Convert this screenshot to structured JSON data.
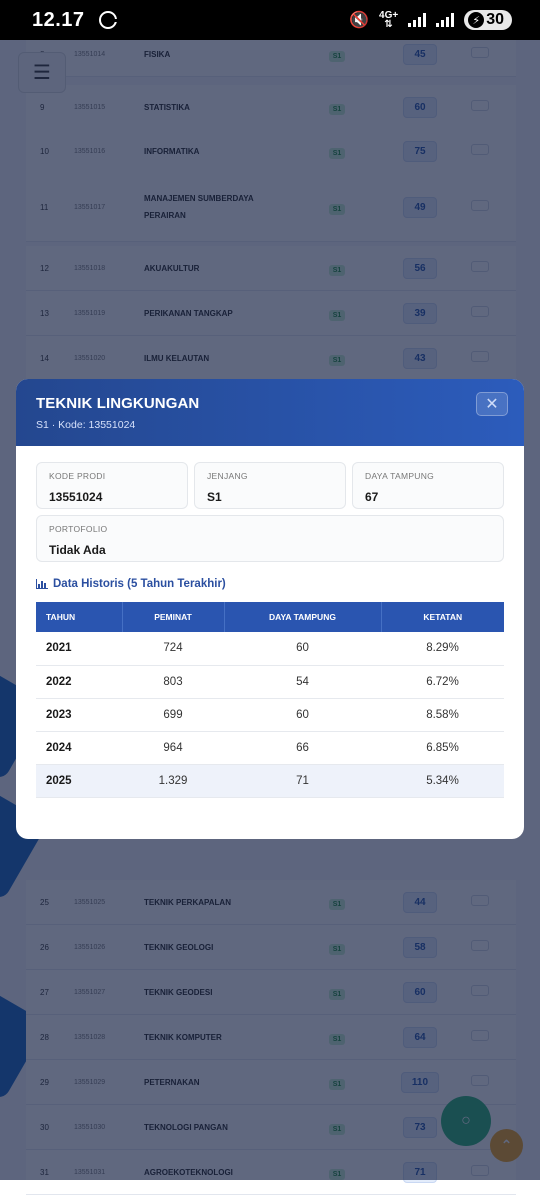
{
  "status_bar": {
    "time": "12.17",
    "network": "4G+",
    "battery": "30"
  },
  "background": {
    "menu_icon": "hamburger-icon",
    "rows": [
      {
        "no": "8",
        "code": "13551014",
        "name": "FISIKA",
        "jenjang": "S1",
        "daya": "45"
      },
      {
        "no": "9",
        "code": "13551015",
        "name": "STATISTIKA",
        "jenjang": "S1",
        "daya": "60"
      },
      {
        "no": "10",
        "code": "13551016",
        "name": "INFORMATIKA",
        "jenjang": "S1",
        "daya": "75"
      },
      {
        "no": "11",
        "code": "13551017",
        "name": "MANAJEMEN SUMBERDAYA PERAIRAN",
        "jenjang": "S1",
        "daya": "49"
      },
      {
        "no": "12",
        "code": "13551018",
        "name": "AKUAKULTUR",
        "jenjang": "S1",
        "daya": "56"
      },
      {
        "no": "13",
        "code": "13551019",
        "name": "PERIKANAN TANGKAP",
        "jenjang": "S1",
        "daya": "39"
      },
      {
        "no": "14",
        "code": "13551020",
        "name": "ILMU KELAUTAN",
        "jenjang": "S1",
        "daya": "43"
      },
      {
        "no": "25",
        "code": "13551025",
        "name": "TEKNIK PERKAPALAN",
        "jenjang": "S1",
        "daya": "44"
      },
      {
        "no": "26",
        "code": "13551026",
        "name": "TEKNIK GEOLOGI",
        "jenjang": "S1",
        "daya": "58"
      },
      {
        "no": "27",
        "code": "13551027",
        "name": "TEKNIK GEODESI",
        "jenjang": "S1",
        "daya": "60"
      },
      {
        "no": "28",
        "code": "13551028",
        "name": "TEKNIK KOMPUTER",
        "jenjang": "S1",
        "daya": "64"
      },
      {
        "no": "29",
        "code": "13551029",
        "name": "PETERNAKAN",
        "jenjang": "S1",
        "daya": "110"
      },
      {
        "no": "30",
        "code": "13551030",
        "name": "TEKNOLOGI PANGAN",
        "jenjang": "S1",
        "daya": "73"
      },
      {
        "no": "31",
        "code": "13551031",
        "name": "AGROEKOTEKNOLOGI",
        "jenjang": "S1",
        "daya": "71"
      }
    ]
  },
  "modal": {
    "title": "TEKNIK LINGKUNGAN",
    "subtitle": "S1 · Kode: 13551024",
    "close_icon": "close-icon",
    "info": {
      "kode_label": "KODE PRODI",
      "kode_value": "13551024",
      "jenjang_label": "JENJANG",
      "jenjang_value": "S1",
      "daya_label": "DAYA TAMPUNG",
      "daya_value": "67",
      "porto_label": "PORTOFOLIO",
      "porto_value": "Tidak Ada"
    },
    "history_title": "Data Historis (5 Tahun Terakhir)",
    "history_icon": "bar-chart-icon",
    "table": {
      "headers": [
        "TAHUN",
        "PEMINAT",
        "DAYA TAMPUNG",
        "KETATAN"
      ],
      "rows": [
        [
          "2021",
          "724",
          "60",
          "8.29%"
        ],
        [
          "2022",
          "803",
          "54",
          "6.72%"
        ],
        [
          "2023",
          "699",
          "60",
          "8.58%"
        ],
        [
          "2024",
          "964",
          "66",
          "6.85%"
        ],
        [
          "2025",
          "1.329",
          "71",
          "5.34%"
        ]
      ]
    }
  }
}
